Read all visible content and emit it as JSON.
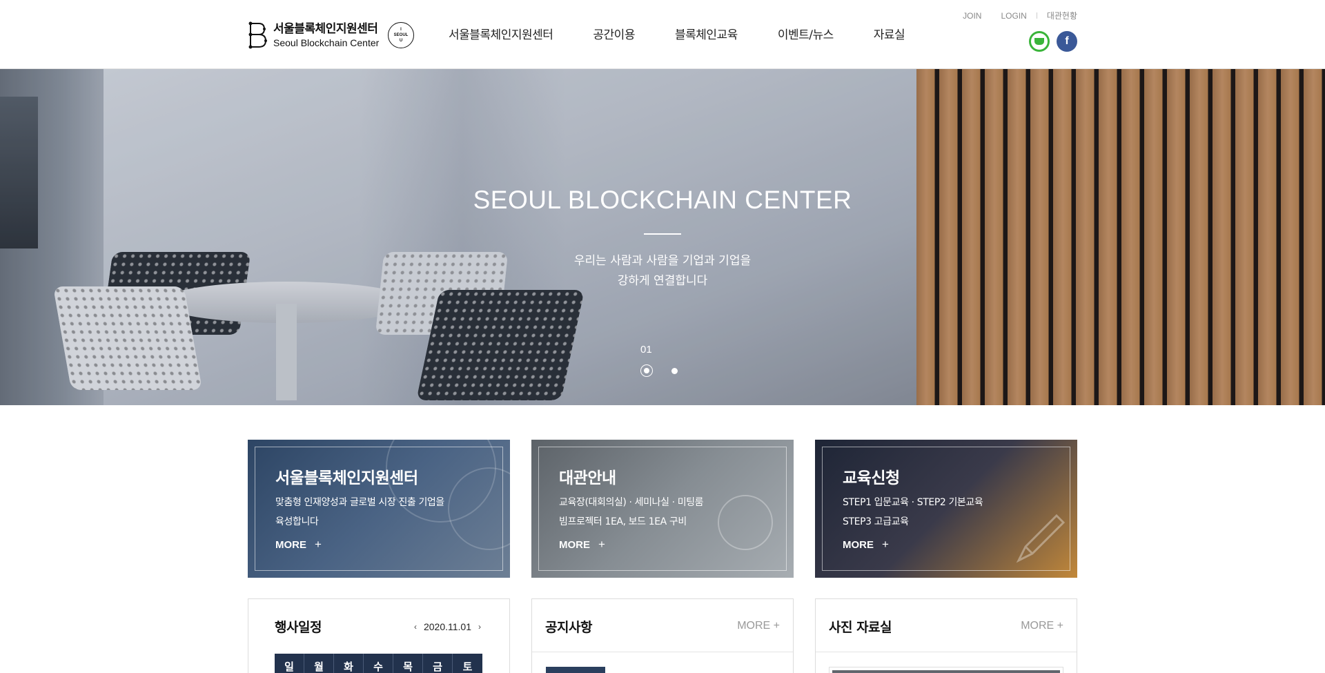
{
  "header": {
    "logo_ko": "서울블록체인지원센터",
    "logo_en": "Seoul Blockchain Center",
    "seoul_badge": [
      "I",
      "SEOUL",
      "U"
    ],
    "nav": [
      "서울블록체인지원센터",
      "공간이용",
      "블록체인교육",
      "이벤트/뉴스",
      "자료실"
    ],
    "util": {
      "join": "JOIN",
      "login": "LOGIN",
      "rental": "대관현황"
    },
    "sns": {
      "kakao_icon": "kakao-story-icon",
      "facebook_icon": "facebook-icon",
      "facebook_glyph": "f"
    }
  },
  "hero": {
    "title": "SEOUL BLOCKCHAIN CENTER",
    "subtitle_line1": "우리는 사람과 사람을 기업과 기업을",
    "subtitle_line2": "강하게 연결합니다",
    "page_number": "01",
    "slide_count": 2,
    "active_slide": 1
  },
  "cards": [
    {
      "title": "서울블록체인지원센터",
      "desc_line1": "맞춤형 인재양성과 글로벌 시장 진출 기업을",
      "desc_line2": "육성합니다",
      "more": "MORE",
      "plus": "+"
    },
    {
      "title": "대관안내",
      "desc_line1": "교육장(대회의실) · 세미나실 · 미팅룸",
      "desc_line2": "빔프로젝터 1EA, 보드 1EA 구비",
      "more": "MORE",
      "plus": "+"
    },
    {
      "title": "교육신청",
      "desc_line1": "STEP1 입문교육 · STEP2 기본교육",
      "desc_line2": "STEP3 고급교육",
      "more": "MORE",
      "plus": "+"
    }
  ],
  "boxes": {
    "calendar": {
      "title": "행사일정",
      "date": "2020.11.01",
      "prev_glyph": "‹",
      "next_glyph": "›",
      "weekdays": [
        "일",
        "월",
        "화",
        "수",
        "목",
        "금",
        "토"
      ]
    },
    "notice": {
      "title": "공지사항",
      "more": "MORE +"
    },
    "photo": {
      "title": "사진 자료실",
      "more": "MORE +"
    }
  },
  "colors": {
    "header_bg": "#ffffff",
    "nav_text": "#222222",
    "kakao_green": "#3ab43a",
    "facebook_blue": "#3b5998",
    "calendar_header": "#22324d",
    "more_gray": "#999999"
  }
}
